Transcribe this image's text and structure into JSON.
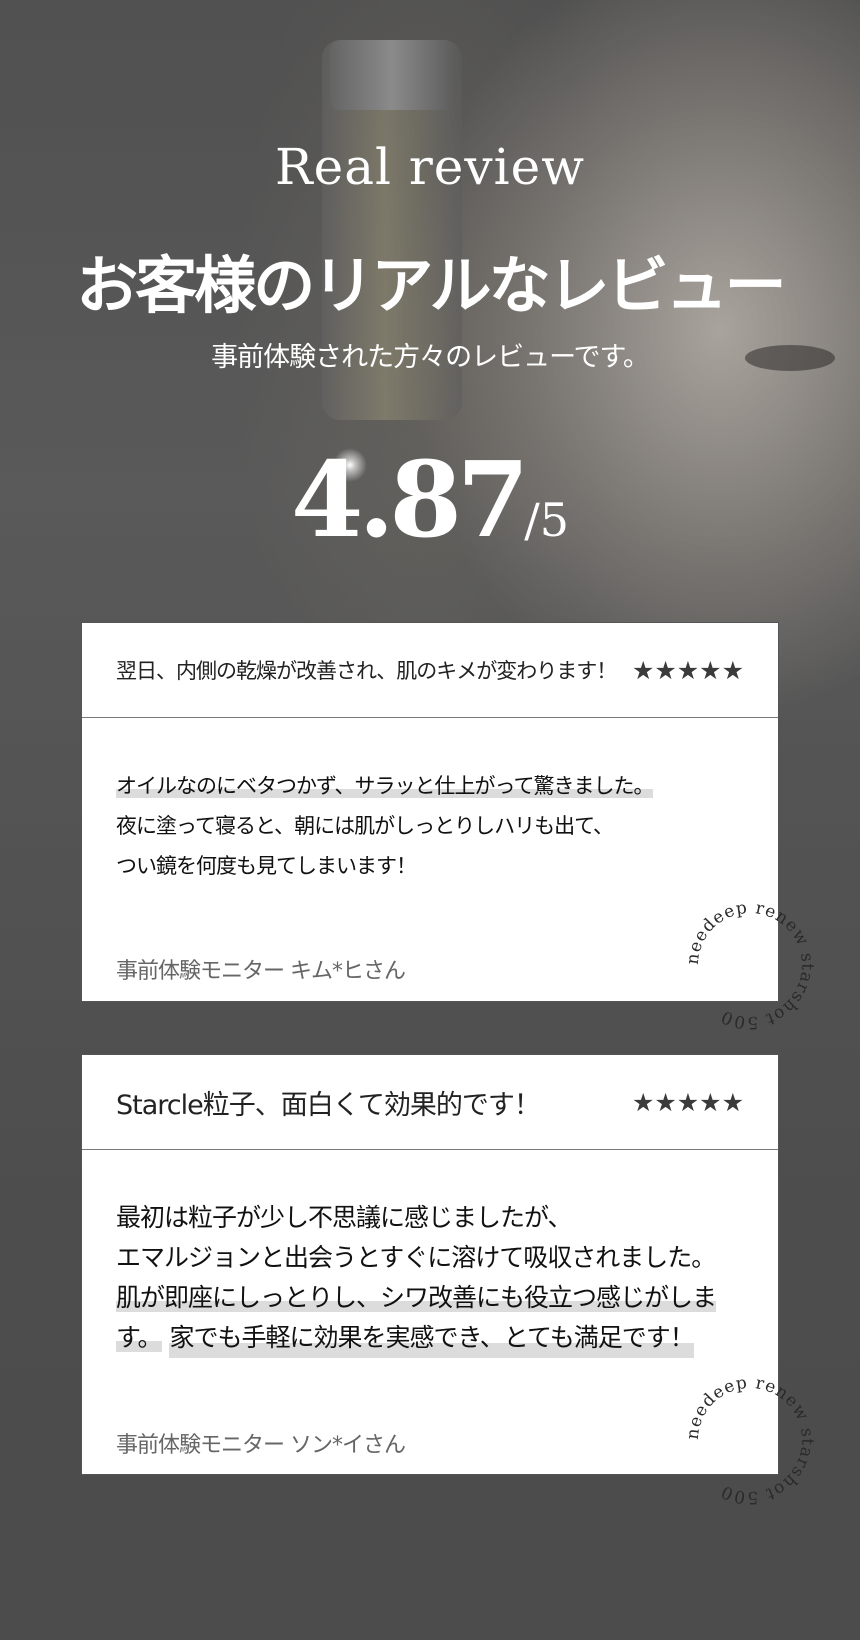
{
  "hero": {
    "eyebrow": "Real review",
    "headline": "お客様のリアルなレビュー",
    "subtitle": "事前体験された方々のレビューです。",
    "score": "4.87",
    "score_denominator": "/5"
  },
  "reviews": [
    {
      "title": "翌日、内側の乾燥が改善され、肌のキメが変わります！",
      "stars": "★★★★★",
      "lines": [
        "オイルなのにベタつかず、サラッと仕上がって驚きました。",
        "夜に塗って寝ると、朝には肌がしっとりしハリも出て、",
        "つい鏡を何度も見てしまいます！"
      ],
      "reviewer": "事前体験モニター キム*ヒさん",
      "stamp_text": "needeep renew starshot 500"
    },
    {
      "title": "Starcle粒子、面白くて効果的です！",
      "stars": "★★★★★",
      "lines": [
        "最初は粒子が少し不思議に感じましたが、",
        "エマルジョンと出会うとすぐに溶けて吸収されました。",
        "肌が即座にしっとりし、シワ改善にも役立つ感じがします。",
        "家でも手軽に効果を実感でき、とても満足です！"
      ],
      "reviewer": "事前体験モニター ソン*イさん",
      "stamp_text": "needeep renew starshot 500"
    }
  ],
  "colors": {
    "card_background": "#ffffff",
    "star_color": "#3b3b3b",
    "highlight": "#dcdcdc"
  }
}
